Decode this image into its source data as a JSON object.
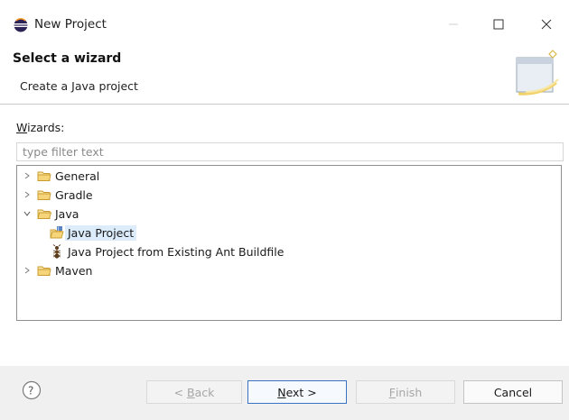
{
  "window": {
    "title": "New Project",
    "controls": {
      "minimize": "—",
      "maximize": "□",
      "close": "✕"
    }
  },
  "header": {
    "title": "Select a wizard",
    "description": "Create a Java project"
  },
  "wizards": {
    "label_accel": "W",
    "label_rest": "izards:",
    "filter_placeholder": "type filter text",
    "filter_value": ""
  },
  "tree": {
    "items": [
      {
        "label": "General",
        "expanded": false,
        "level": 0,
        "icon": "folder-icon"
      },
      {
        "label": "Gradle",
        "expanded": false,
        "level": 0,
        "icon": "folder-icon"
      },
      {
        "label": "Java",
        "expanded": true,
        "level": 0,
        "icon": "folder-icon"
      },
      {
        "label": "Java Project",
        "level": 1,
        "icon": "java-project-icon",
        "selected": true
      },
      {
        "label": "Java Project from Existing Ant Buildfile",
        "level": 1,
        "icon": "ant-icon"
      },
      {
        "label": "Maven",
        "expanded": false,
        "level": 0,
        "icon": "folder-icon"
      }
    ]
  },
  "footer": {
    "help": "?",
    "back_accel": "B",
    "back_prefix": "< ",
    "back_rest": "ack",
    "next_accel": "N",
    "next_rest": "ext >",
    "finish_accel": "F",
    "finish_rest": "inish",
    "cancel": "Cancel"
  },
  "colors": {
    "selection": "#dcecfb",
    "default_button_border": "#3a73c4",
    "folder": "#e8b84a"
  }
}
